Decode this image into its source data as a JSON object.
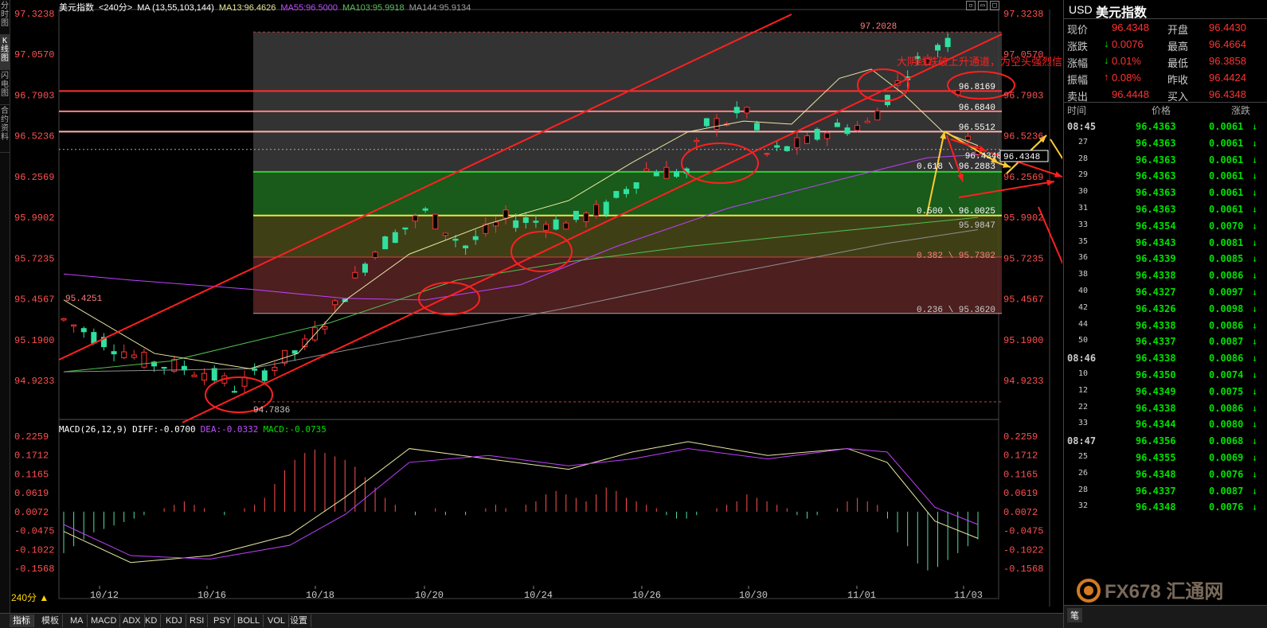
{
  "left_tabs": [
    "分时图",
    "K线图",
    "闪电图",
    "合约资料"
  ],
  "info": {
    "name": "美元指数",
    "period": "<240分>",
    "ma_label": "MA (13,55,103,144)",
    "ma13": "MA13:96.4626",
    "ma55": "MA55:96.5000",
    "ma103": "MA103:95.9918",
    "ma144": "MA144:95.9134"
  },
  "macd": {
    "label": "MACD(26,12,9)",
    "diff": "DIFF:-0.0700",
    "dea": "DEA:-0.0332",
    "macd": "MACD:-0.0735"
  },
  "price_axis": [
    "97.3238",
    "97.0570",
    "96.7903",
    "96.5236",
    "96.2569",
    "95.9902",
    "95.7235",
    "95.4567",
    "95.1900",
    "94.9233"
  ],
  "macd_axis": [
    "0.2259",
    "0.1712",
    "0.1165",
    "0.0619",
    "0.0072",
    "-0.0475",
    "-0.1022",
    "-0.1568"
  ],
  "date_axis": [
    "10/12",
    "10/16",
    "10/18",
    "10/20",
    "10/24",
    "10/26",
    "10/30",
    "11/01",
    "11/03"
  ],
  "labels": {
    "high": "97.2028",
    "low": "94.7836",
    "left_high": "95.4251",
    "current": "96.4348",
    "fib_1": "96.8169",
    "fib_2": "96.6840",
    "fib_3": "96.5512",
    "fib_618": "0.618 \\ 96.2883",
    "fib_500": "0.500 \\ 96.0025",
    "fib_382": "0.382 \\ 95.7302",
    "fib_236": "0.236 \\ 95.3620",
    "ma_val": "95.9847",
    "annotation": "大阴线跌破上升通道，为空头强烈信号"
  },
  "period_button": "240分 ▲",
  "bottom_tabs": [
    "指标",
    "模板",
    "MA",
    "MACD",
    "ADX",
    "KD",
    "KDJ",
    "RSI",
    "PSY",
    "BOLL",
    "VOL",
    "设置"
  ],
  "side": {
    "symbol": "USD",
    "name": "美元指数",
    "quote_rows": [
      {
        "l1": "现价",
        "v1": "96.4348",
        "l2": "开盘",
        "v2": "96.4430"
      },
      {
        "l1": "涨跌",
        "v1": "0.0076",
        "l2": "最高",
        "v2": "96.4664"
      },
      {
        "l1": "涨幅",
        "v1": "0.01%",
        "l2": "最低",
        "v2": "96.3858"
      },
      {
        "l1": "振幅",
        "v1": "0.08%",
        "l2": "昨收",
        "v2": "96.4424"
      },
      {
        "l1": "卖出",
        "v1": "96.4448",
        "l2": "买入",
        "v2": "96.4348"
      }
    ],
    "tick_header": {
      "time": "时间",
      "price": "价格",
      "change": "涨跌"
    },
    "ticks": [
      {
        "t": "08:45",
        "p": "96.4363",
        "c": "0.0061"
      },
      {
        "t": "27",
        "p": "96.4363",
        "c": "0.0061"
      },
      {
        "t": "28",
        "p": "96.4363",
        "c": "0.0061"
      },
      {
        "t": "29",
        "p": "96.4363",
        "c": "0.0061"
      },
      {
        "t": "30",
        "p": "96.4363",
        "c": "0.0061"
      },
      {
        "t": "31",
        "p": "96.4363",
        "c": "0.0061"
      },
      {
        "t": "33",
        "p": "96.4354",
        "c": "0.0070"
      },
      {
        "t": "35",
        "p": "96.4343",
        "c": "0.0081"
      },
      {
        "t": "36",
        "p": "96.4339",
        "c": "0.0085"
      },
      {
        "t": "38",
        "p": "96.4338",
        "c": "0.0086"
      },
      {
        "t": "40",
        "p": "96.4327",
        "c": "0.0097"
      },
      {
        "t": "42",
        "p": "96.4326",
        "c": "0.0098"
      },
      {
        "t": "44",
        "p": "96.4338",
        "c": "0.0086"
      },
      {
        "t": "50",
        "p": "96.4337",
        "c": "0.0087"
      },
      {
        "t": "08:46",
        "p": "96.4338",
        "c": "0.0086"
      },
      {
        "t": "10",
        "p": "96.4350",
        "c": "0.0074"
      },
      {
        "t": "12",
        "p": "96.4349",
        "c": "0.0075"
      },
      {
        "t": "22",
        "p": "96.4338",
        "c": "0.0086"
      },
      {
        "t": "33",
        "p": "96.4344",
        "c": "0.0080"
      },
      {
        "t": "08:47",
        "p": "96.4356",
        "c": "0.0068"
      },
      {
        "t": "25",
        "p": "96.4355",
        "c": "0.0069"
      },
      {
        "t": "26",
        "p": "96.4348",
        "c": "0.0076"
      },
      {
        "t": "28",
        "p": "96.4337",
        "c": "0.0087"
      },
      {
        "t": "32",
        "p": "96.4348",
        "c": "0.0076"
      }
    ],
    "footer_tab": "笔",
    "logo": "FX678 汇通网"
  },
  "colors": {
    "up": "#ff3232",
    "down": "#54ffff",
    "green": "#00e000",
    "yellow": "#ffd700"
  }
}
